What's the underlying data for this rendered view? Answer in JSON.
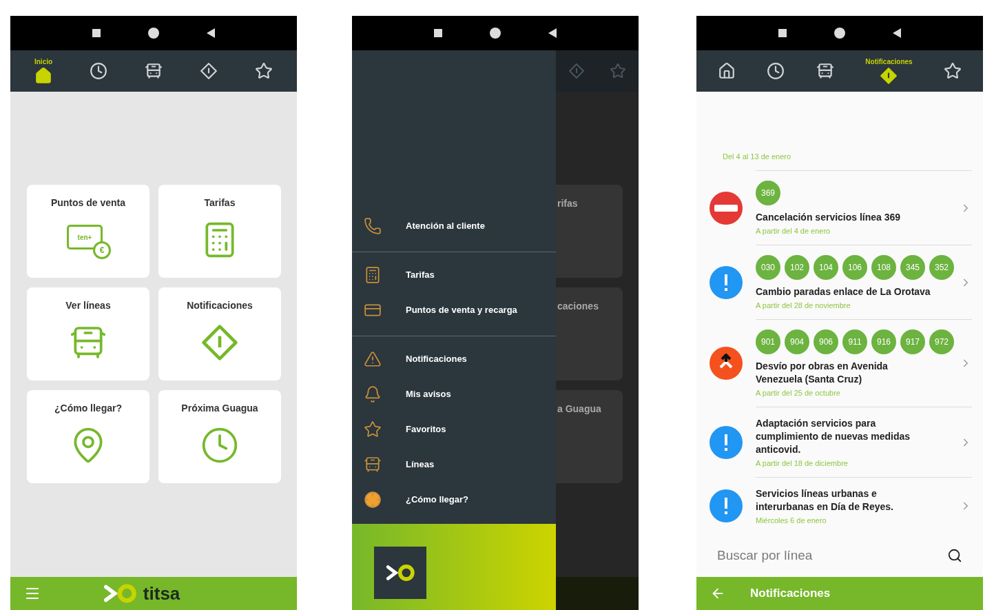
{
  "phones": [
    {
      "kind": "home",
      "tabs": [
        {
          "kind": "home",
          "label": "Inicio",
          "selected": true
        },
        {
          "kind": "clock",
          "selected": false
        },
        {
          "kind": "bus",
          "selected": false
        },
        {
          "kind": "alert",
          "selected": false
        },
        {
          "kind": "star",
          "selected": false
        }
      ],
      "cards": [
        {
          "label": "Puntos de venta",
          "kind": "card",
          "badge": "ten+",
          "coin": "€"
        },
        {
          "label": "Tarifas",
          "kind": "calc"
        },
        {
          "label": "Ver líneas",
          "kind": "bus"
        },
        {
          "label": "Notificaciones",
          "kind": "alert"
        },
        {
          "label": "¿Cómo llegar?",
          "kind": "pin"
        },
        {
          "label": "Próxima Guagua",
          "kind": "clock"
        }
      ],
      "app_bar": {
        "brand": "titsa"
      }
    },
    {
      "kind": "drawer",
      "background_labels": [
        "rifas",
        "caciones",
        "a Guagua"
      ],
      "sections": [
        [
          {
            "kind": "phone",
            "label": "Atención al cliente"
          }
        ],
        [
          {
            "kind": "calc",
            "label": "Tarifas"
          },
          {
            "kind": "card",
            "label": "Puntos de venta y recarga"
          }
        ],
        [
          {
            "kind": "warning",
            "label": "Notificaciones"
          },
          {
            "kind": "bell",
            "label": "Mis avisos"
          },
          {
            "kind": "star",
            "label": "Favoritos"
          },
          {
            "kind": "bus",
            "label": "Líneas"
          },
          {
            "kind": "pin",
            "label": "¿Cómo llegar?"
          }
        ]
      ]
    },
    {
      "kind": "notifications",
      "tabs": [
        {
          "kind": "home",
          "selected": false
        },
        {
          "kind": "clock",
          "selected": false
        },
        {
          "kind": "bus",
          "selected": false
        },
        {
          "kind": "alert",
          "label": "Notificaciones",
          "selected": true
        },
        {
          "kind": "star",
          "selected": false
        }
      ],
      "notifications": [
        {
          "date": "Del 4 al 13 de enero"
        },
        {
          "kind": "stop",
          "lines": [
            "369"
          ],
          "title": "Cancelación servicios línea 369",
          "date": "A partir del 4 de enero"
        },
        {
          "kind": "info",
          "lines": [
            "030",
            "102",
            "104",
            "106",
            "108",
            "345",
            "352"
          ],
          "title": "Cambio paradas enlace de La Orotava",
          "date": "A partir del 28 de noviembre"
        },
        {
          "kind": "detour",
          "lines": [
            "901",
            "904",
            "906",
            "911",
            "916",
            "917",
            "972"
          ],
          "title": "Desvío por obras en Avenida Venezuela (Santa Cruz)",
          "date": "A partir del 25 de octubre"
        },
        {
          "kind": "info",
          "title": "Adaptación servicios para cumplimiento de nuevas medidas anticovid.",
          "date": "A partir del 18 de diciembre"
        },
        {
          "kind": "info",
          "title": "Servicios líneas urbanas e interurbanas en Día de Reyes.",
          "date": "Miércoles 6 de enero"
        }
      ],
      "search": {
        "placeholder": "Buscar por línea"
      },
      "app_bar": {
        "title": "Notificaciones"
      }
    }
  ]
}
